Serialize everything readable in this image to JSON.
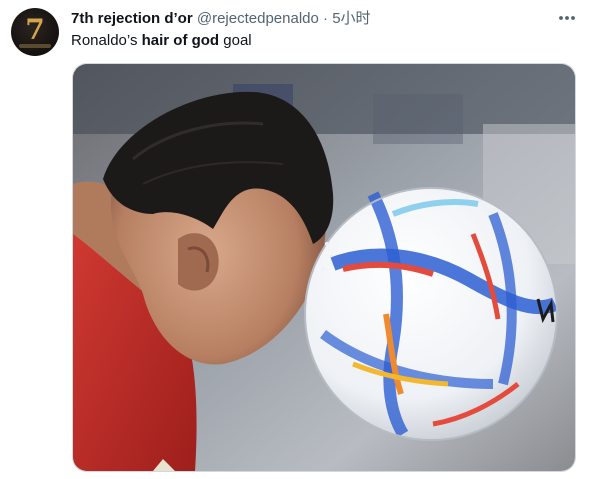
{
  "author": {
    "display_name": "7th rejection d’or",
    "handle": "@rejectedpenaldo",
    "separator": "·",
    "timestamp": "5小时",
    "avatar_numeral": "7"
  },
  "tweet": {
    "text_before": "Ronaldo’s ",
    "text_bold": "hair of god",
    "text_after": " goal"
  },
  "media": {
    "description_icon": "photo"
  },
  "icons": {
    "more": "more-horizontal-icon"
  },
  "colors": {
    "text_primary": "#0f1419",
    "text_secondary": "#536471",
    "border": "#cfd9de",
    "jersey_red": "#c4302b"
  }
}
